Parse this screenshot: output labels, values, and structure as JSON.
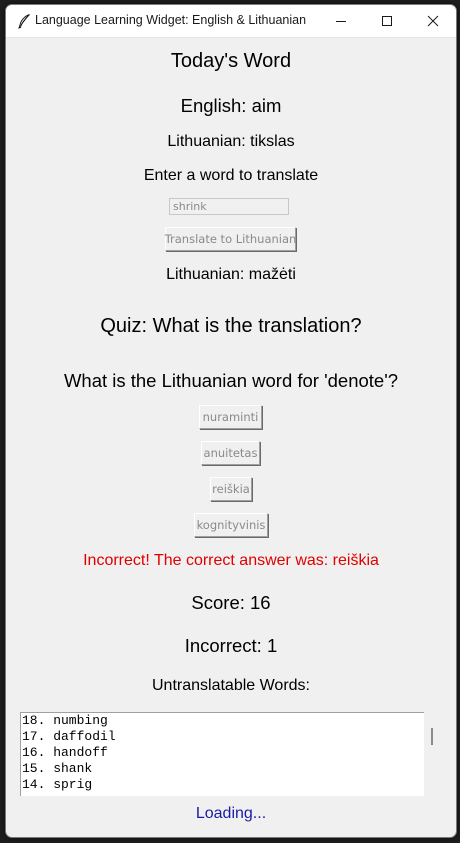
{
  "window": {
    "title": "Language Learning Widget: English & Lithuanian"
  },
  "word_of_day": {
    "heading": "Today's Word",
    "english": "English: aim",
    "lithuanian": "Lithuanian: tikslas"
  },
  "translator": {
    "prompt": "Enter a word to translate",
    "input_value": "shrink",
    "button_label": "Translate to Lithuanian",
    "result": "Lithuanian: mažėti"
  },
  "quiz": {
    "heading": "Quiz: What is the translation?",
    "question": "What is the Lithuanian word for 'denote'?",
    "options": [
      "nuraminti",
      "anuitetas",
      "reiškia",
      "kognityvinis"
    ],
    "feedback": "Incorrect! The correct answer was: reiškia",
    "feedback_color": "#e00000"
  },
  "stats": {
    "score": "Score: 16",
    "incorrect": "Incorrect: 1"
  },
  "untranslatable": {
    "heading": "Untranslatable Words:",
    "items": [
      "18. numbing",
      "17. daffodil",
      "16. handoff",
      "15. shank",
      "14. sprig"
    ]
  },
  "status": {
    "text": "Loading...",
    "color": "#1a1aa6"
  },
  "icons": {
    "app": "feather-icon",
    "minimize": "minimize-icon",
    "maximize": "maximize-icon",
    "close": "close-icon"
  }
}
